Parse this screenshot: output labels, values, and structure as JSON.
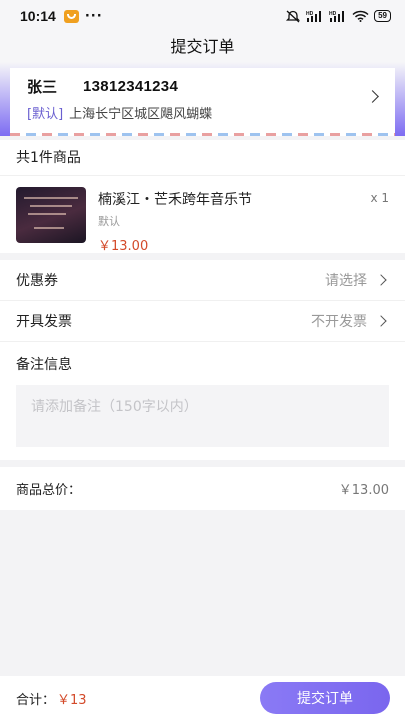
{
  "status_bar": {
    "time": "10:14",
    "more": "···",
    "battery": "59",
    "icons": [
      "mute-icon",
      "signal-hd-icon",
      "signal-hd-icon",
      "wifi-icon",
      "battery-icon"
    ]
  },
  "header": {
    "title": "提交订单"
  },
  "address": {
    "name": "张三",
    "phone": "13812341234",
    "default_tag": "[默认]",
    "detail": "上海长宁区城区飓风蝴蝶"
  },
  "goods": {
    "count_label": "共1件商品",
    "items": [
      {
        "name": "楠溪江・芒禾跨年音乐节",
        "spec": "默认",
        "price": "￥13.00",
        "qty": "x 1"
      }
    ]
  },
  "options": {
    "coupon": {
      "label": "优惠券",
      "value": "请选择"
    },
    "invoice": {
      "label": "开具发票",
      "value": "不开发票"
    },
    "remark": {
      "label": "备注信息",
      "placeholder": "请添加备注（150字以内）"
    }
  },
  "total": {
    "label": "商品总价：",
    "value": "￥13.00"
  },
  "footer": {
    "sum_label": "合计：",
    "sum_value": "￥13",
    "submit_label": "提交订单"
  },
  "colors": {
    "accent": "#7a66ee",
    "price": "#d34a2a"
  }
}
